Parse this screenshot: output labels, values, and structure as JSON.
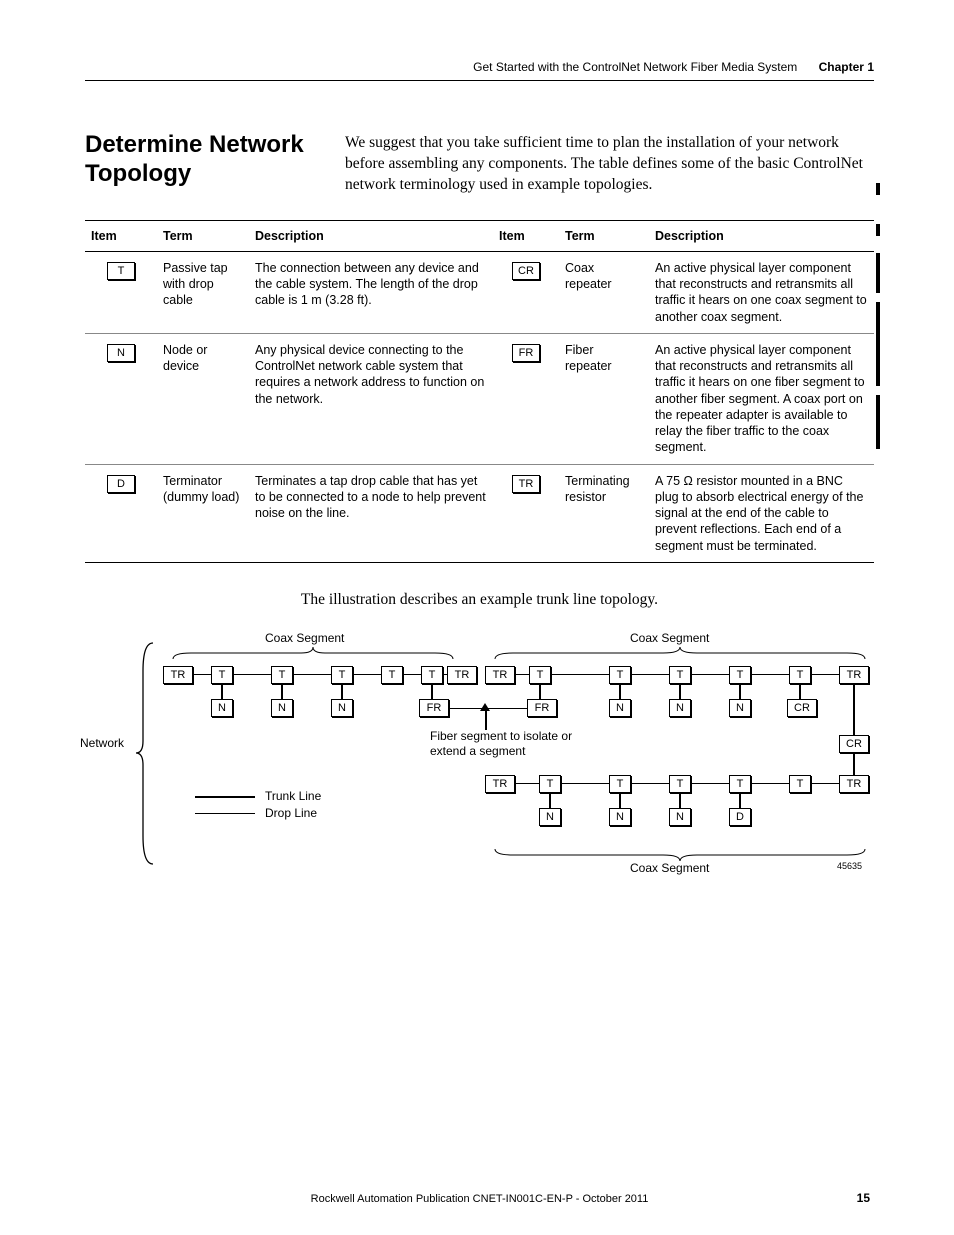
{
  "header": {
    "text": "Get Started with the ControlNet Network Fiber Media System",
    "chapter": "Chapter 1"
  },
  "section_title_l1": "Determine Network",
  "section_title_l2": "Topology",
  "intro": "We suggest that you take sufficient time to plan the installation of your network before assembling any components. The table defines some of the basic ControlNet network terminology used in example topologies.",
  "table": {
    "h": {
      "item": "Item",
      "term": "Term",
      "desc": "Description"
    },
    "r1": {
      "sym1": "T",
      "term1": "Passive tap with drop cable",
      "desc1": "The connection between any device and the cable system. The length of the drop cable is 1 m (3.28 ft).",
      "sym2": "CR",
      "term2": "Coax repeater",
      "desc2": "An active physical layer component that reconstructs and retransmits all traffic it hears on one coax segment to another coax segment."
    },
    "r2": {
      "sym1": "N",
      "term1": "Node or device",
      "desc1": "Any physical device connecting to the ControlNet network cable system that requires a network address to function on the network.",
      "sym2": "FR",
      "term2": "Fiber repeater",
      "desc2": "An active physical layer component that reconstructs and retransmits all traffic it hears on one fiber segment to another fiber segment. A coax port on the repeater adapter is available to relay the fiber traffic to the coax segment."
    },
    "r3": {
      "sym1": "D",
      "term1": "Terminator (dummy load)",
      "desc1": "Terminates a tap drop cable that has yet to be connected to a node to help prevent noise on the line.",
      "sym2": "TR",
      "term2": "Terminating resistor",
      "desc2": "A 75 Ω resistor mounted in a BNC plug to absorb electrical energy of the signal at the end of the cable to prevent reflections. Each end of a segment must be terminated."
    }
  },
  "illustration_caption": "The illustration describes an example trunk line topology.",
  "diagram": {
    "network": "Network",
    "coax_segment": "Coax Segment",
    "fiber_note_l1": "Fiber segment to isolate or",
    "fiber_note_l2": "extend a segment",
    "trunk": "Trunk Line",
    "drop": "Drop Line",
    "figno": "45635",
    "TR": "TR",
    "T": "T",
    "N": "N",
    "FR": "FR",
    "CR": "CR",
    "D": "D"
  },
  "footer": {
    "text": "Rockwell Automation Publication CNET-IN001C-EN-P - October 2011",
    "page": "15"
  }
}
